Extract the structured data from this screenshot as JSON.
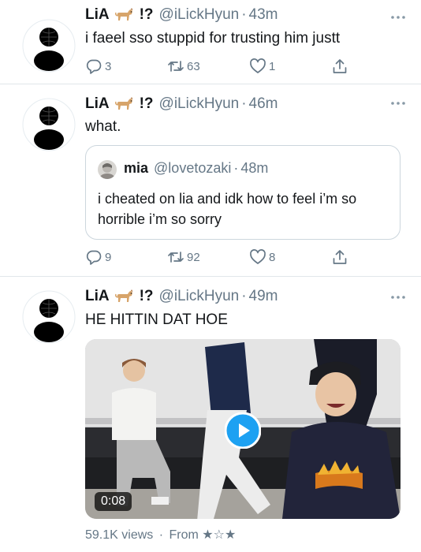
{
  "tweets": [
    {
      "name": "LiA",
      "marks": "!?",
      "handle": "@iLickHyun",
      "separator": "·",
      "time": "43m",
      "text": "i faeel sso stuppid  for trusting him justt",
      "replies": "3",
      "retweets": "63",
      "likes": "1"
    },
    {
      "name": "LiA",
      "marks": "!?",
      "handle": "@iLickHyun",
      "separator": "·",
      "time": "46m",
      "text": "what.",
      "replies": "9",
      "retweets": "92",
      "likes": "8",
      "quote": {
        "name": "mia",
        "handle": "@lovetozaki",
        "separator": "·",
        "time": "48m",
        "text": "i cheated on lia and idk how to feel i’m so horrible i’m so sorry"
      }
    },
    {
      "name": "LiA",
      "marks": "!?",
      "handle": "@iLickHyun",
      "separator": "·",
      "time": "49m",
      "text": "HE HITTIN DAT HOE",
      "video": {
        "duration": "0:08",
        "views": "59.1K views",
        "from_prefix": "From",
        "from_stars": "★☆★"
      }
    }
  ],
  "icons": {
    "emoji": "dog-emoji",
    "reply": "reply-icon",
    "retweet": "retweet-icon",
    "like": "heart-icon",
    "share": "share-icon",
    "more": "more-icon",
    "play": "play-icon"
  },
  "colors": {
    "text": "#14171a",
    "muted": "#657786",
    "accent": "#1da1f2",
    "divider": "#e1e6ea"
  }
}
